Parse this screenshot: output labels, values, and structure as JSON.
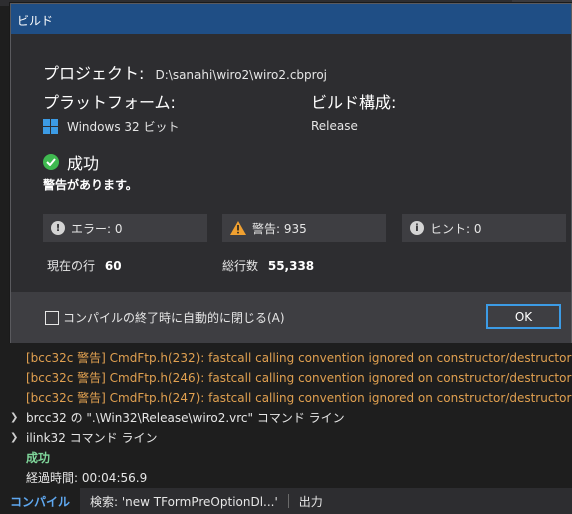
{
  "dialog": {
    "title": "ビルド",
    "project_label": "プロジェクト:",
    "project_path": "D:\\sanahi\\wiro2\\wiro2.cbproj",
    "platform_label": "プラットフォーム:",
    "platform_value": "Windows 32 ビット",
    "config_label": "ビルド構成:",
    "config_value": "Release",
    "status": "成功",
    "warning_notice": "警告があります。",
    "errors_text": "エラー: 0",
    "warnings_text": "警告: 935",
    "hints_text": "ヒント: 0",
    "current_line_label": "現在の行",
    "current_line_value": "60",
    "total_lines_label": "総行数",
    "total_lines_value": "55,338",
    "autoclose_label": "コンパイルの終了時に自動的に閉じる(A)",
    "ok_label": "OK"
  },
  "output": {
    "lines": [
      "[bcc32c 警告] CmdFtp.h(232): fastcall calling convention ignored on constructor/destructor",
      "[bcc32c 警告] CmdFtp.h(246): fastcall calling convention ignored on constructor/destructor",
      "[bcc32c 警告] CmdFtp.h(247): fastcall calling convention ignored on constructor/destructor",
      "brcc32 の \".\\Win32\\Release\\wiro2.vrc\" コマンド ライン",
      "ilink32 コマンド ライン",
      "成功",
      "経過時間: 00:04:56.9"
    ]
  },
  "tabs": {
    "compile": "コンパイル",
    "search": "検索: 'new TFormPreOptionDl...'",
    "output": "出力"
  },
  "colors": {
    "accent": "#3c9be5",
    "titlebar": "#1f4e85",
    "success": "#3fb950",
    "warning": "#e0a050"
  }
}
